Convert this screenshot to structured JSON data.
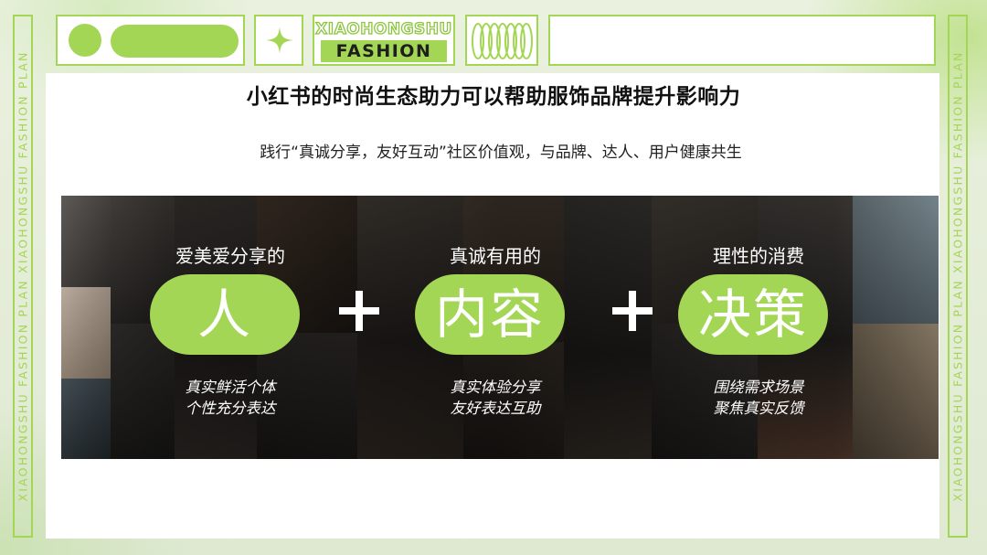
{
  "frame": {
    "side_text": "XIAOHONGSHU FASHION PLAN XIAOHONGSHU FASHION PLAN",
    "brand_line1": "XIAOHONGSHU",
    "brand_line2": "FASHION"
  },
  "slide": {
    "title": "小红书的时尚生态助力可以帮助服饰品牌提升影响力",
    "subtitle": "践行“真诚分享，友好互动”社区价值观，与品牌、达人、用户健康共生"
  },
  "pillars": [
    {
      "caption": "爱美爱分享的",
      "word": "人",
      "desc1": "真实鲜活个体",
      "desc2": "个性充分表达"
    },
    {
      "caption": "真诚有用的",
      "word": "内容",
      "desc1": "真实体验分享",
      "desc2": "友好表达互助"
    },
    {
      "caption": "理性的消费",
      "word": "决策",
      "desc1": "围绕需求场景",
      "desc2": "聚焦真实反馈"
    }
  ],
  "colors": {
    "accent_green": "#a3d654",
    "panel": "#ffffff",
    "band_dark": "#151515"
  }
}
